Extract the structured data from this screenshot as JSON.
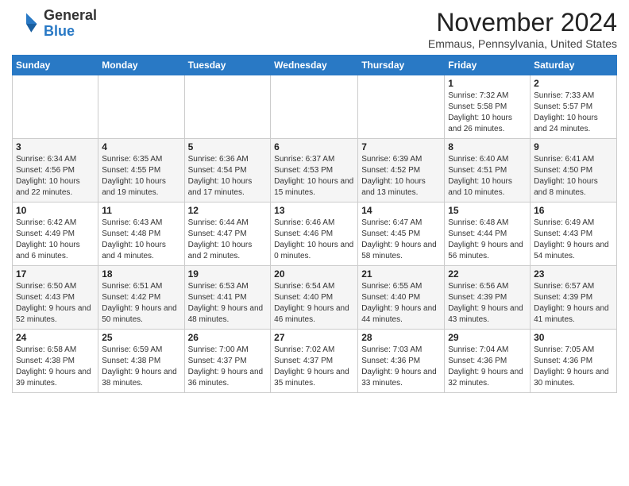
{
  "header": {
    "logo_line1": "General",
    "logo_line2": "Blue",
    "month": "November 2024",
    "location": "Emmaus, Pennsylvania, United States"
  },
  "days_of_week": [
    "Sunday",
    "Monday",
    "Tuesday",
    "Wednesday",
    "Thursday",
    "Friday",
    "Saturday"
  ],
  "weeks": [
    [
      {
        "day": "",
        "info": ""
      },
      {
        "day": "",
        "info": ""
      },
      {
        "day": "",
        "info": ""
      },
      {
        "day": "",
        "info": ""
      },
      {
        "day": "",
        "info": ""
      },
      {
        "day": "1",
        "info": "Sunrise: 7:32 AM\nSunset: 5:58 PM\nDaylight: 10 hours and 26 minutes."
      },
      {
        "day": "2",
        "info": "Sunrise: 7:33 AM\nSunset: 5:57 PM\nDaylight: 10 hours and 24 minutes."
      }
    ],
    [
      {
        "day": "3",
        "info": "Sunrise: 6:34 AM\nSunset: 4:56 PM\nDaylight: 10 hours and 22 minutes."
      },
      {
        "day": "4",
        "info": "Sunrise: 6:35 AM\nSunset: 4:55 PM\nDaylight: 10 hours and 19 minutes."
      },
      {
        "day": "5",
        "info": "Sunrise: 6:36 AM\nSunset: 4:54 PM\nDaylight: 10 hours and 17 minutes."
      },
      {
        "day": "6",
        "info": "Sunrise: 6:37 AM\nSunset: 4:53 PM\nDaylight: 10 hours and 15 minutes."
      },
      {
        "day": "7",
        "info": "Sunrise: 6:39 AM\nSunset: 4:52 PM\nDaylight: 10 hours and 13 minutes."
      },
      {
        "day": "8",
        "info": "Sunrise: 6:40 AM\nSunset: 4:51 PM\nDaylight: 10 hours and 10 minutes."
      },
      {
        "day": "9",
        "info": "Sunrise: 6:41 AM\nSunset: 4:50 PM\nDaylight: 10 hours and 8 minutes."
      }
    ],
    [
      {
        "day": "10",
        "info": "Sunrise: 6:42 AM\nSunset: 4:49 PM\nDaylight: 10 hours and 6 minutes."
      },
      {
        "day": "11",
        "info": "Sunrise: 6:43 AM\nSunset: 4:48 PM\nDaylight: 10 hours and 4 minutes."
      },
      {
        "day": "12",
        "info": "Sunrise: 6:44 AM\nSunset: 4:47 PM\nDaylight: 10 hours and 2 minutes."
      },
      {
        "day": "13",
        "info": "Sunrise: 6:46 AM\nSunset: 4:46 PM\nDaylight: 10 hours and 0 minutes."
      },
      {
        "day": "14",
        "info": "Sunrise: 6:47 AM\nSunset: 4:45 PM\nDaylight: 9 hours and 58 minutes."
      },
      {
        "day": "15",
        "info": "Sunrise: 6:48 AM\nSunset: 4:44 PM\nDaylight: 9 hours and 56 minutes."
      },
      {
        "day": "16",
        "info": "Sunrise: 6:49 AM\nSunset: 4:43 PM\nDaylight: 9 hours and 54 minutes."
      }
    ],
    [
      {
        "day": "17",
        "info": "Sunrise: 6:50 AM\nSunset: 4:43 PM\nDaylight: 9 hours and 52 minutes."
      },
      {
        "day": "18",
        "info": "Sunrise: 6:51 AM\nSunset: 4:42 PM\nDaylight: 9 hours and 50 minutes."
      },
      {
        "day": "19",
        "info": "Sunrise: 6:53 AM\nSunset: 4:41 PM\nDaylight: 9 hours and 48 minutes."
      },
      {
        "day": "20",
        "info": "Sunrise: 6:54 AM\nSunset: 4:40 PM\nDaylight: 9 hours and 46 minutes."
      },
      {
        "day": "21",
        "info": "Sunrise: 6:55 AM\nSunset: 4:40 PM\nDaylight: 9 hours and 44 minutes."
      },
      {
        "day": "22",
        "info": "Sunrise: 6:56 AM\nSunset: 4:39 PM\nDaylight: 9 hours and 43 minutes."
      },
      {
        "day": "23",
        "info": "Sunrise: 6:57 AM\nSunset: 4:39 PM\nDaylight: 9 hours and 41 minutes."
      }
    ],
    [
      {
        "day": "24",
        "info": "Sunrise: 6:58 AM\nSunset: 4:38 PM\nDaylight: 9 hours and 39 minutes."
      },
      {
        "day": "25",
        "info": "Sunrise: 6:59 AM\nSunset: 4:38 PM\nDaylight: 9 hours and 38 minutes."
      },
      {
        "day": "26",
        "info": "Sunrise: 7:00 AM\nSunset: 4:37 PM\nDaylight: 9 hours and 36 minutes."
      },
      {
        "day": "27",
        "info": "Sunrise: 7:02 AM\nSunset: 4:37 PM\nDaylight: 9 hours and 35 minutes."
      },
      {
        "day": "28",
        "info": "Sunrise: 7:03 AM\nSunset: 4:36 PM\nDaylight: 9 hours and 33 minutes."
      },
      {
        "day": "29",
        "info": "Sunrise: 7:04 AM\nSunset: 4:36 PM\nDaylight: 9 hours and 32 minutes."
      },
      {
        "day": "30",
        "info": "Sunrise: 7:05 AM\nSunset: 4:36 PM\nDaylight: 9 hours and 30 minutes."
      }
    ]
  ]
}
